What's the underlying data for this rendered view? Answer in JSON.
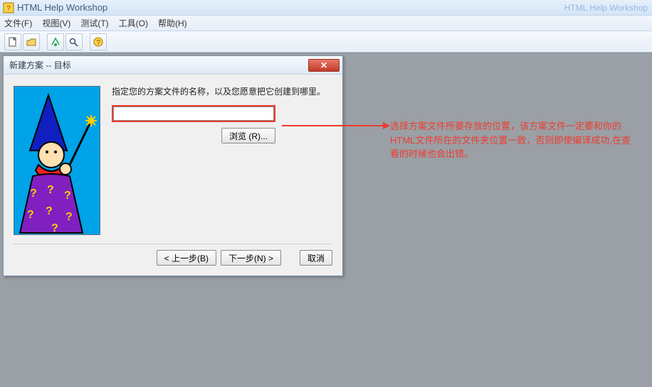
{
  "app": {
    "title": "HTML Help Workshop",
    "task_hint": "HTML Help Workshop"
  },
  "menu": {
    "file": "文件(F)",
    "view": "视图(V)",
    "test": "测试(T)",
    "tools": "工具(O)",
    "help": "帮助(H)"
  },
  "dialog": {
    "title": "新建方案 -- 目标",
    "instruction": "指定您的方案文件的名称，以及您愿意把它创建到哪里。",
    "path_value": "",
    "browse": "浏览 (R)...",
    "back": "< 上一步(B)",
    "next": "下一步(N) >",
    "cancel": "取消",
    "close_glyph": "✕"
  },
  "annotation": {
    "text": "选择方案文件所要存放的位置，该方案文件一定要和你的HTML文件所在的文件夹位置一致，否则即使编译成功,在查看的时候也会出错。"
  }
}
